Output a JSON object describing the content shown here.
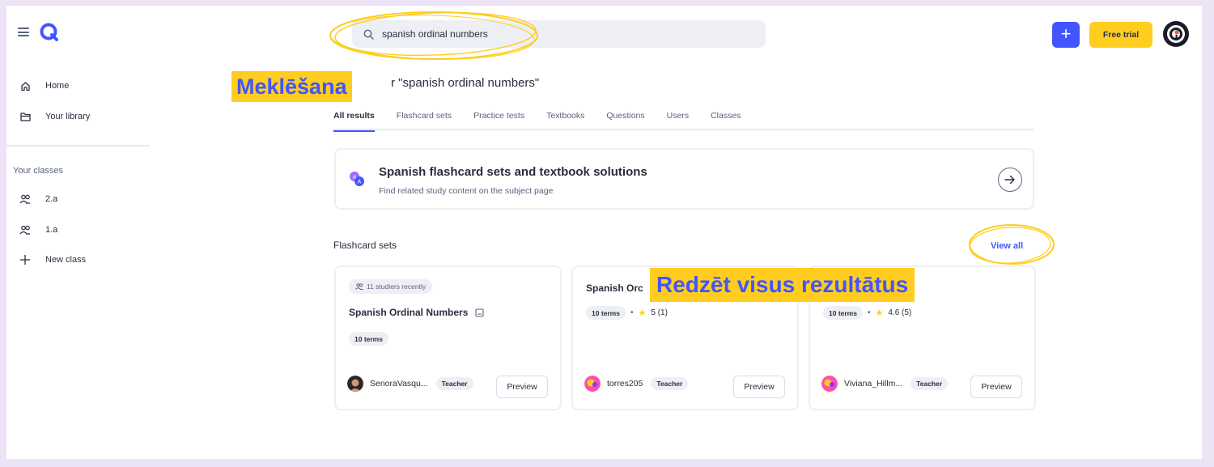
{
  "header": {
    "search_value": "spanish ordinal numbers",
    "free_trial_label": "Free trial",
    "plus_label": "+"
  },
  "sidebar": {
    "items": [
      {
        "label": "Home",
        "icon": "home-icon"
      },
      {
        "label": "Your library",
        "icon": "folder-icon"
      }
    ],
    "classes_heading": "Your classes",
    "classes": [
      {
        "label": "2.a",
        "icon": "group-icon"
      },
      {
        "label": "1.a",
        "icon": "group-icon"
      }
    ],
    "new_class_label": "New class"
  },
  "results": {
    "title": "r \"spanish ordinal numbers\"",
    "tabs": [
      "All results",
      "Flashcard sets",
      "Practice tests",
      "Textbooks",
      "Questions",
      "Users",
      "Classes"
    ],
    "active_tab": "All results"
  },
  "subject_card": {
    "title": "Spanish flashcard sets and textbook solutions",
    "description": "Find related study content on the subject page"
  },
  "flashcards": {
    "heading": "Flashcard sets",
    "view_all_label": "View all",
    "cards": [
      {
        "studiers": "11 studiers recently",
        "title": "Spanish Ordinal Numbers",
        "terms": "10 terms",
        "rating": "",
        "author": "SenoraVasqu...",
        "role": "Teacher",
        "preview": "Preview"
      },
      {
        "studiers": "",
        "title": "Spanish Orc",
        "terms": "10 terms",
        "rating": "5 (1)",
        "author": "torres205",
        "role": "Teacher",
        "preview": "Preview"
      },
      {
        "studiers": "",
        "title": "",
        "terms": "10 terms",
        "rating": "4.6 (5)",
        "author": "Viviana_Hillm...",
        "role": "Teacher",
        "preview": "Preview"
      }
    ]
  },
  "annotations": {
    "search_label": "Meklēšana",
    "view_all_label": "Redzēt visus rezultātus"
  },
  "colors": {
    "accent": "#4255ff",
    "highlight": "#ffcd1f",
    "background": "#ede3f6"
  }
}
